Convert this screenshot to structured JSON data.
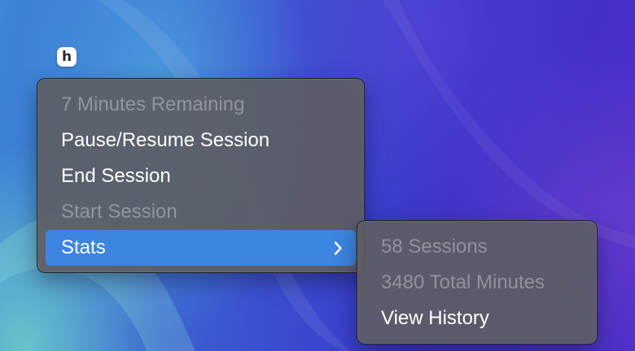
{
  "desktop": {
    "app_icon_glyph": "h"
  },
  "colors": {
    "menu_background": "#5c5e64",
    "highlight": "#3c85e0",
    "text_enabled": "#ffffff",
    "text_disabled": "#8b8c91"
  },
  "menu": {
    "items": [
      {
        "label": "7 Minutes Remaining",
        "enabled": false
      },
      {
        "label": "Pause/Resume Session",
        "enabled": true
      },
      {
        "label": "End Session",
        "enabled": true
      },
      {
        "label": "Start Session",
        "enabled": false
      },
      {
        "label": "Stats",
        "enabled": true,
        "highlighted": true,
        "has_submenu": true,
        "submenu_icon": "chevron-right-icon"
      }
    ]
  },
  "submenu": {
    "items": [
      {
        "label": "58 Sessions",
        "enabled": false
      },
      {
        "label": "3480 Total Minutes",
        "enabled": false
      },
      {
        "label": "View History",
        "enabled": true
      }
    ]
  }
}
